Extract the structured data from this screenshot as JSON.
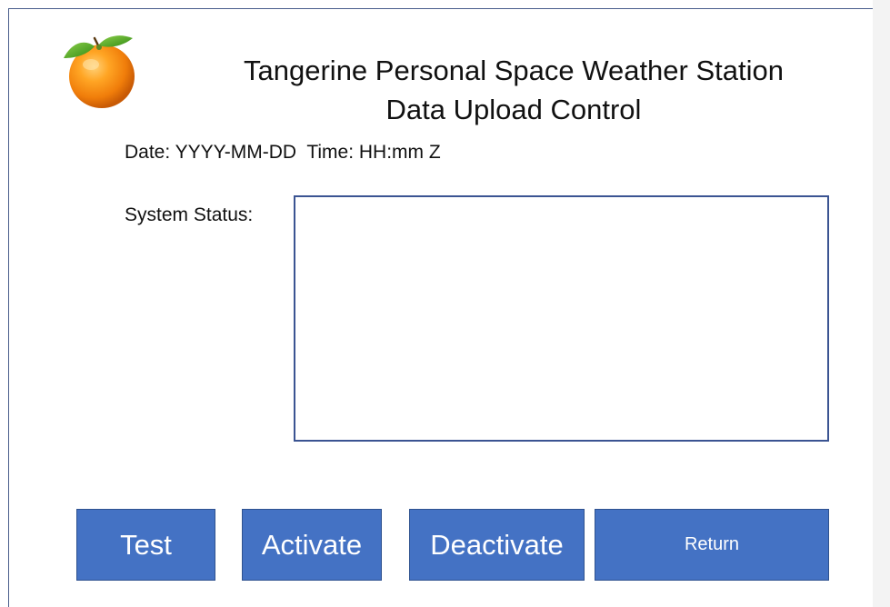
{
  "header": {
    "title_line_1": "Tangerine Personal Space Weather Station",
    "title_line_2": "Data Upload Control",
    "logo_icon": "tangerine-icon"
  },
  "datetime": {
    "text": "Date: YYYY-MM-DD  Time: HH:mm Z"
  },
  "status": {
    "label": "System Status:",
    "value": ""
  },
  "buttons": {
    "test": "Test",
    "activate": "Activate",
    "deactivate": "Deactivate",
    "return": "Return"
  },
  "colors": {
    "button_fill": "#4472c4",
    "button_border": "#2f528f",
    "status_box_border": "#3b5492",
    "panel_border": "#4a5e8c",
    "tangerine_orange": "#f08a0c",
    "leaf_green": "#3f9a1c"
  }
}
